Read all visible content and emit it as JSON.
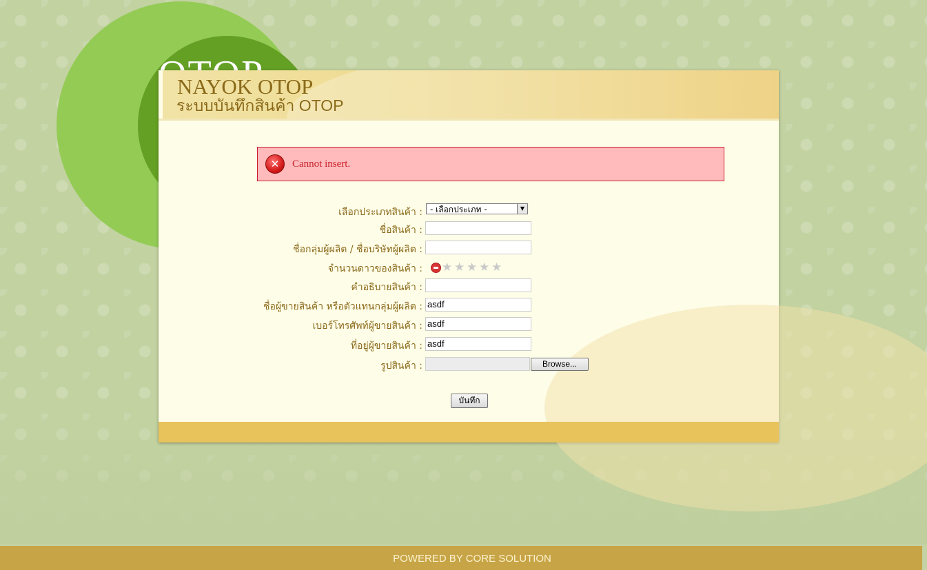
{
  "brand": {
    "logo_text": "OTOP"
  },
  "header": {
    "title": "NAYOK OTOP",
    "subtitle": "ระบบบันทึกสินค้า OTOP"
  },
  "alert": {
    "type": "error",
    "message": "Cannot insert.",
    "icon": "error-circle-x-icon"
  },
  "form": {
    "category": {
      "label": "เลือกประเภทสินค้า :",
      "selected": "- เลือกประเภท -"
    },
    "product_name": {
      "label": "ชื่อสินค้า :",
      "value": ""
    },
    "producer_group": {
      "label": "ชื่อกลุ่มผู้ผลิต / ชื่อบริษัทผู้ผลิต :",
      "value": ""
    },
    "star_rating": {
      "label": "จำนวนดาวของสินค้า :",
      "value": 0,
      "max": 5
    },
    "description": {
      "label": "คำอธิบายสินค้า :",
      "value": ""
    },
    "seller_name": {
      "label": "ชื่อผู้ขายสินค้า หรือตัวแทนกลุ่มผู้ผลิต :",
      "value": "asdf"
    },
    "seller_phone": {
      "label": "เบอร์โทรศัพท์ผู้ขายสินค้า :",
      "value": "asdf"
    },
    "seller_address": {
      "label": "ที่อยู่ผู้ขายสินค้า :",
      "value": "asdf"
    },
    "product_image": {
      "label": "รูปสินค้า :",
      "browse_label": "Browse..."
    },
    "submit_label": "บันทึก"
  },
  "footer": {
    "text": "POWERED BY CORE SOLUTION"
  },
  "colors": {
    "accent": "#e8c35c",
    "label": "#8a6a1a",
    "error": "#c81f2c",
    "error_bg": "#ffbbbb",
    "footer": "#c7a445"
  }
}
